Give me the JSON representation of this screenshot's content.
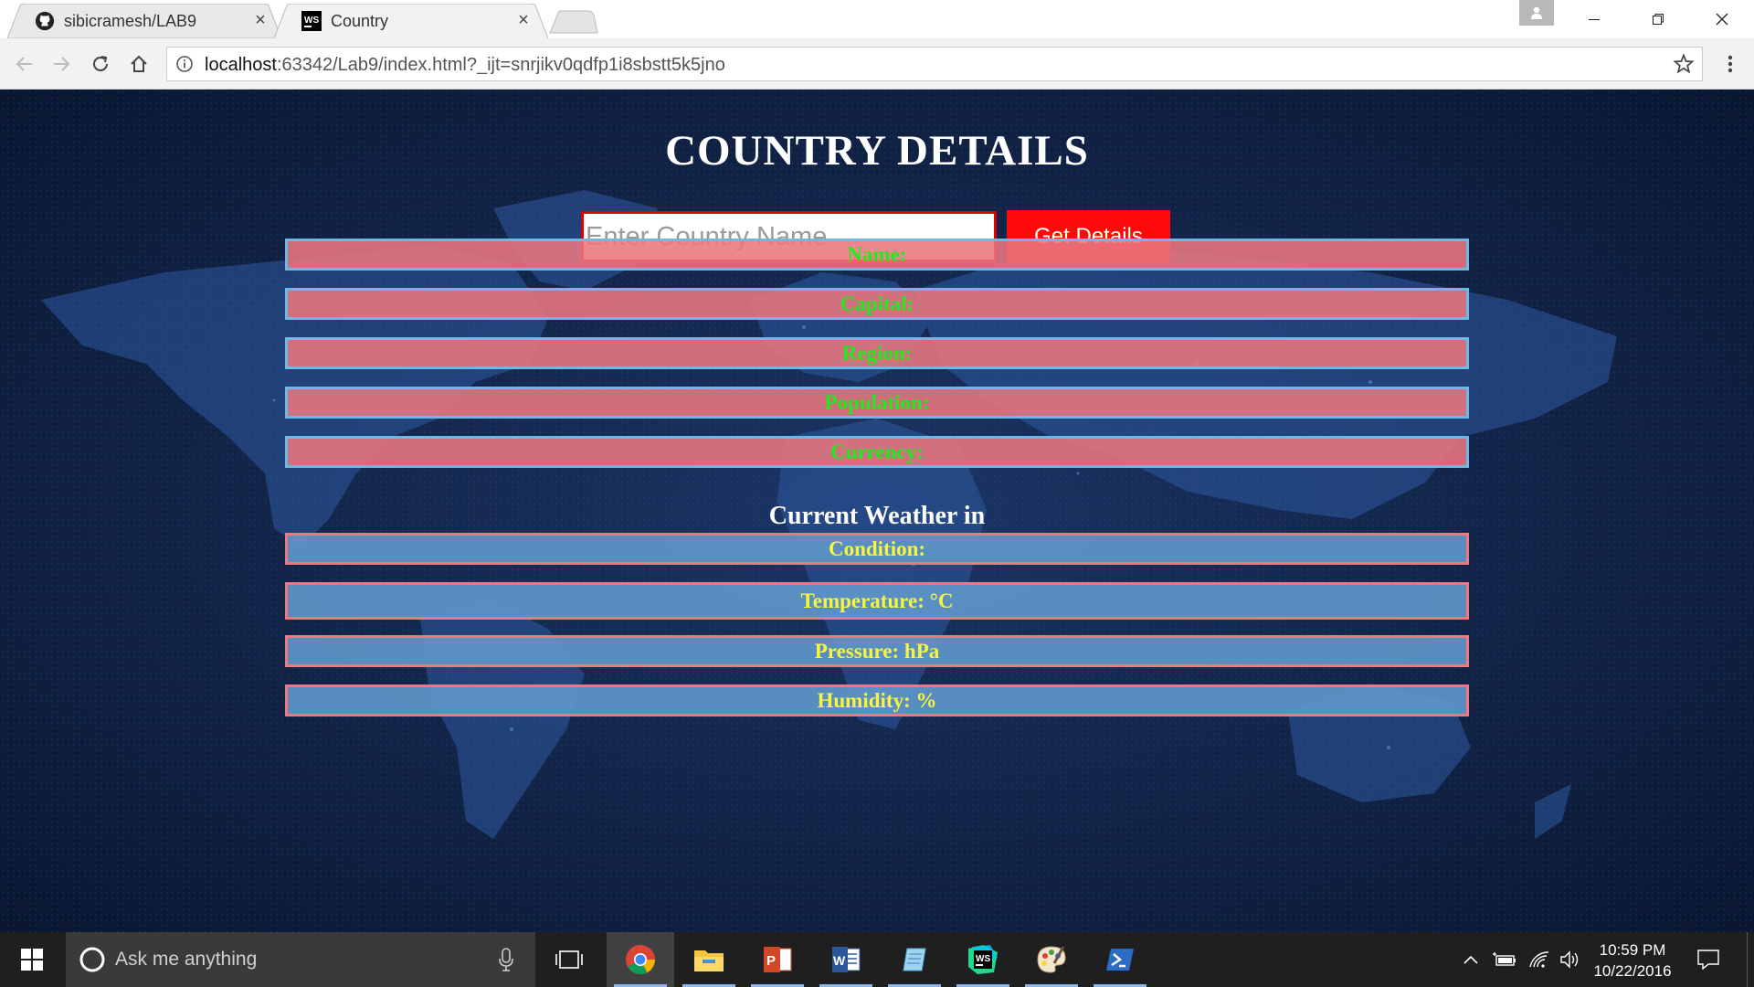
{
  "browser": {
    "tabs": [
      {
        "title": "sibicramesh/LAB9",
        "icon": "github-icon",
        "active": false
      },
      {
        "title": "Country",
        "icon": "webstorm-icon",
        "active": true
      }
    ],
    "url": {
      "host": "localhost",
      "rest": ":63342/Lab9/index.html?_ijt=snrjikv0qdfp1i8sbstt5k5jno"
    }
  },
  "page": {
    "title": "COUNTRY DETAILS",
    "search": {
      "placeholder": "Enter Country Name",
      "value": "",
      "button_label": "Get Details"
    },
    "country_fields": [
      {
        "label": "Name:"
      },
      {
        "label": "Capital:"
      },
      {
        "label": "Region:"
      },
      {
        "label": "Population:"
      },
      {
        "label": "Currency:"
      }
    ],
    "weather_heading": "Current Weather in",
    "weather_fields": [
      {
        "label": "Condition:"
      },
      {
        "label": "Temperature: °C"
      },
      {
        "label": "Pressure: hPa"
      },
      {
        "label": "Humidity: %"
      }
    ],
    "colors": {
      "country_row_bg": "#e9767e",
      "country_row_border": "#6cb9e6",
      "country_text": "#22e81e",
      "weather_row_bg": "#6096c9",
      "weather_row_border": "#f07682",
      "weather_text": "#f6f640",
      "button_bg": "#ff0a0a"
    }
  },
  "taskbar": {
    "search_placeholder": "Ask me anything",
    "apps": [
      "chrome-icon",
      "file-explorer-icon",
      "powerpoint-icon",
      "word-icon",
      "notepad-icon",
      "webstorm-icon",
      "paint-icon",
      "powershell-icon"
    ],
    "time": "10:59 PM",
    "date": "10/22/2016"
  }
}
